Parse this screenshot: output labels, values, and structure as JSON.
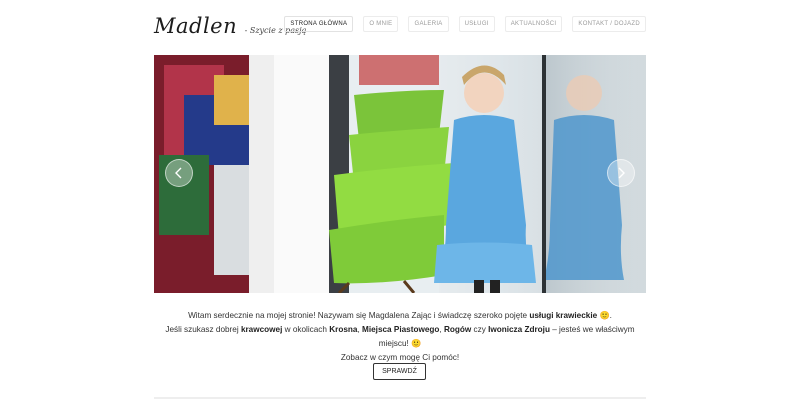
{
  "brand": {
    "name": "Madlen",
    "tagline": "- Szycie z pasją"
  },
  "nav": {
    "items": [
      {
        "label": "Strona główna",
        "active": true
      },
      {
        "label": "O mnie"
      },
      {
        "label": "Galeria"
      },
      {
        "label": "Usługi"
      },
      {
        "label": "Aktualności"
      },
      {
        "label": "Kontakt / Dojazd"
      }
    ]
  },
  "slider": {
    "prev_icon": "chevron-left-icon",
    "next_icon": "chevron-right-icon"
  },
  "intro": {
    "l1_a": "Witam serdecznie na mojej stronie! Nazywam się Magdalena Zając i świadczę szeroko pojęte ",
    "l1_b": "usługi krawieckie",
    "l1_c": " 🙂.",
    "l2_a": "Jeśli szukasz dobrej ",
    "l2_b": "krawcowej",
    "l2_c": " w okolicach ",
    "l2_d": "Krosna",
    "l2_e": ", ",
    "l2_f": "Miejsca Piastowego",
    "l2_g": ", ",
    "l2_h": "Rogów",
    "l2_i": " czy ",
    "l2_j": "Iwonicza Zdroju",
    "l2_k": " – jesteś we właściwym miejscu! 🙂",
    "l3": "Zobacz w czym mogę Ci pomóc!"
  },
  "cta_label": "Sprawdź"
}
